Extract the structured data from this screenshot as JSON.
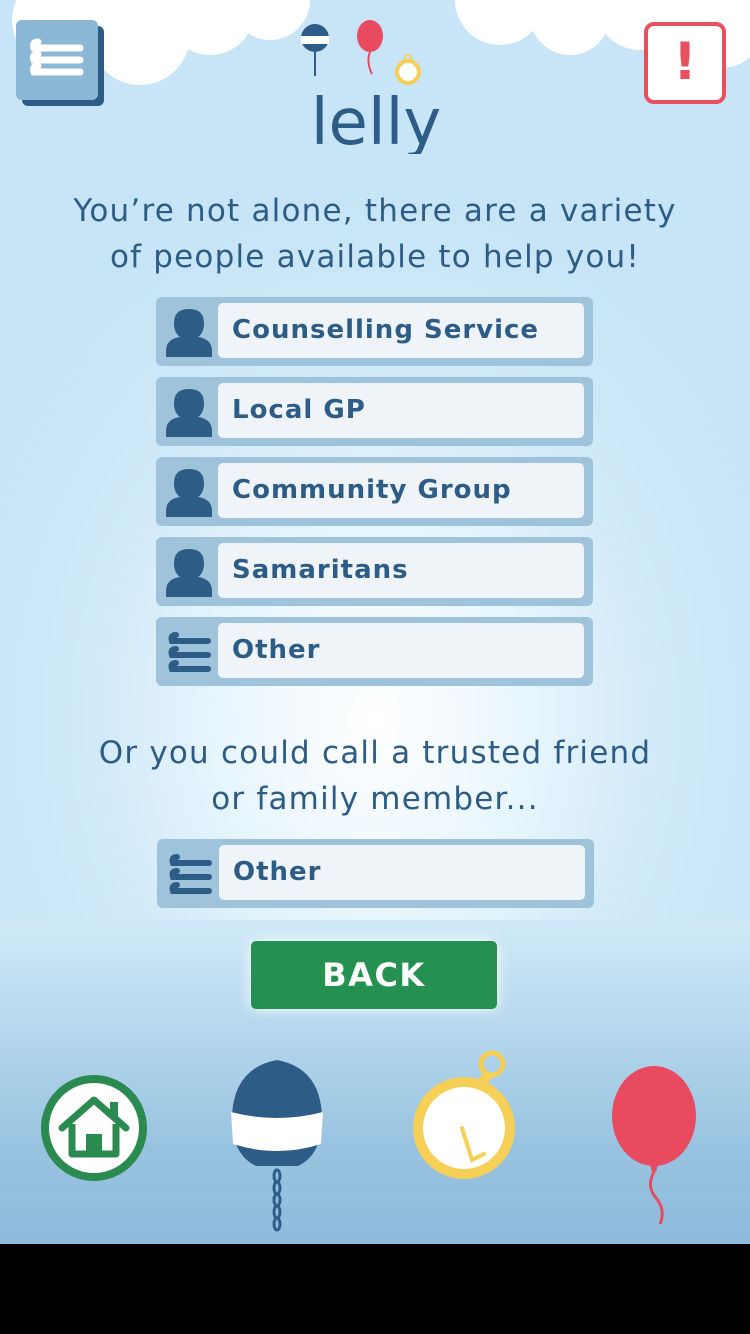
{
  "header": {
    "logo_text": "lelly",
    "alert_label": "!"
  },
  "main": {
    "intro_line1": "You’re not alone, there are a variety",
    "intro_line2": "of people available to help you!",
    "options": [
      {
        "label": "Counselling Service",
        "icon": "person-icon"
      },
      {
        "label": "Local GP",
        "icon": "person-icon"
      },
      {
        "label": "Community Group",
        "icon": "person-icon"
      },
      {
        "label": "Samaritans",
        "icon": "person-icon"
      },
      {
        "label": "Other",
        "icon": "lines-icon"
      }
    ],
    "friend_line1": "Or you could call a trusted friend",
    "friend_line2": "or family member...",
    "friend_option": {
      "label": "Other",
      "icon": "lines-icon"
    },
    "back_label": "BACK"
  },
  "nav": {
    "items": [
      "home-icon",
      "buoy-icon",
      "stopwatch-icon",
      "balloon-icon"
    ]
  },
  "colors": {
    "primary_text": "#2d5c86",
    "back_button": "#249150",
    "alert": "#e8505f",
    "option_frame": "#9ec3da",
    "home_green": "#2b8a4f",
    "balloon_red": "#e84a5f",
    "stopwatch_yellow": "#f6cf57"
  }
}
